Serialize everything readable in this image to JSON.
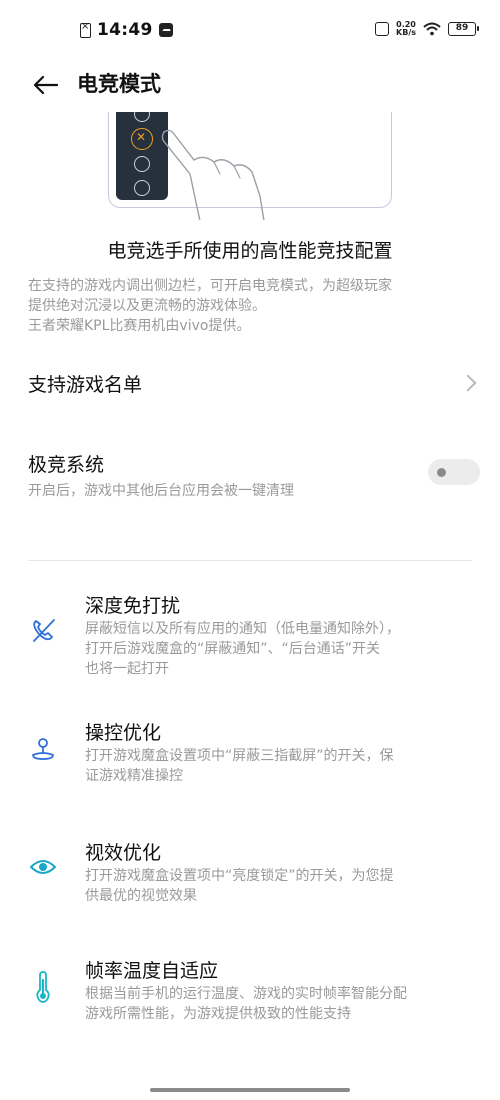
{
  "status_bar": {
    "time": "14:49",
    "net_speed_value": "0.20",
    "net_speed_unit": "KB/s",
    "battery": "89"
  },
  "header": {
    "title": "电竞模式"
  },
  "intro": {
    "title": "电竞选手所使用的高性能竞技配置",
    "desc_lines": [
      "在支持的游戏内调出侧边栏，可开启电竞模式，为超级玩家",
      "提供绝对沉浸以及更流畅的游戏体验。",
      "王者荣耀KPL比赛用机由vivo提供。"
    ]
  },
  "support_list": {
    "label": "支持游戏名单"
  },
  "extreme_system": {
    "label": "极竞系统",
    "desc": "开启后，游戏中其他后台应用会被一键清理",
    "enabled": false
  },
  "features": [
    {
      "icon": "phone-muted-icon",
      "title": "深度免打扰",
      "desc_lines": [
        "屏蔽短信以及所有应用的通知（低电量通知除外），",
        "打开后游戏魔盒的“屏蔽通知”、“后台通话”开关",
        "也将一起打开"
      ]
    },
    {
      "icon": "joystick-icon",
      "title": "操控优化",
      "desc_lines": [
        "打开游戏魔盒设置项中“屏蔽三指截屏”的开关，保",
        "证游戏精准操控"
      ]
    },
    {
      "icon": "eye-icon",
      "title": "视效优化",
      "desc_lines": [
        "打开游戏魔盒设置项中“亮度锁定”的开关，为您提",
        "供最优的视觉效果"
      ]
    },
    {
      "icon": "thermometer-icon",
      "title": "帧率温度自适应",
      "desc_lines": [
        "根据当前手机的运行温度、游戏的实时帧率智能分配",
        "游戏所需性能，为游戏提供极致的性能支持"
      ]
    }
  ],
  "colors": {
    "accent_blue": "#2f6fd8",
    "accent_cyan": "#19b6c7",
    "sidebar_dark": "#26313d",
    "highlight_orange": "#f0a023"
  }
}
